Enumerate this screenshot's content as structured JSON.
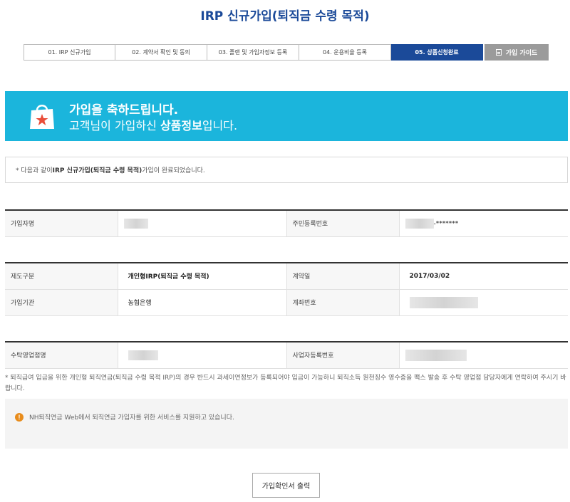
{
  "page": {
    "title": "IRP 신규가입(퇴직금 수령 목적)"
  },
  "steps": [
    {
      "label": "01. IRP 신규가입",
      "active": false
    },
    {
      "label": "02. 계약서 확인 및 동의",
      "active": false
    },
    {
      "label": "03. 플랜 및 가입자정보 등록",
      "active": false
    },
    {
      "label": "04. 운용비율 등록",
      "active": false
    },
    {
      "label": "05. 상품신청완료",
      "active": true
    }
  ],
  "guide_button": {
    "label": "가입 가이드"
  },
  "banner": {
    "title": "가입을 축하드립니다.",
    "sub_pre": "고객님이 가입하신 ",
    "sub_bold": "상품정보",
    "sub_post": "입니다."
  },
  "notice": {
    "pre": "* 다음과 같이 ",
    "bold": "IRP 신규가입(퇴직금 수령 목적)",
    "post": " 가입이 완료되었습니다."
  },
  "subscriber": {
    "name_label": "가입자명",
    "rrn_label": "주민등록번호",
    "rrn_mask": "-*******"
  },
  "contract": {
    "type_label": "제도구분",
    "type_value": "개인형IRP(퇴직금 수령 목적)",
    "date_label": "계약일",
    "date_value": "2017/03/02",
    "org_label": "가입기관",
    "org_value": "농협은행",
    "account_label": "계좌번호"
  },
  "branch": {
    "branch_label": "수탁영업점명",
    "bizno_label": "사업자등록번호"
  },
  "footnote": "* 퇴직급여 입금을 위한 개인형 퇴직연금(퇴직금 수령 목적 IRP)의 경우 반드시 과세이연정보가 등록되어야 입금이 가능하니 퇴직소득 원천징수 영수증을 팩스 발송 후 수탁 영업점 담당자에게 연락하여 주시기 바랍니다.",
  "info_panel": {
    "text": "NH퇴직연금 Web에서 퇴직연금 가입자를 위한 서비스를 지원하고 있습니다."
  },
  "print_button": {
    "label": "가입확인서 출력"
  },
  "colors": {
    "primary": "#1b4a99",
    "banner": "#1bb5dc",
    "warning": "#e88c1c"
  },
  "icons": {
    "banner": "shopping-bag-star-icon",
    "guide": "document-icon",
    "info": "warning-icon"
  }
}
